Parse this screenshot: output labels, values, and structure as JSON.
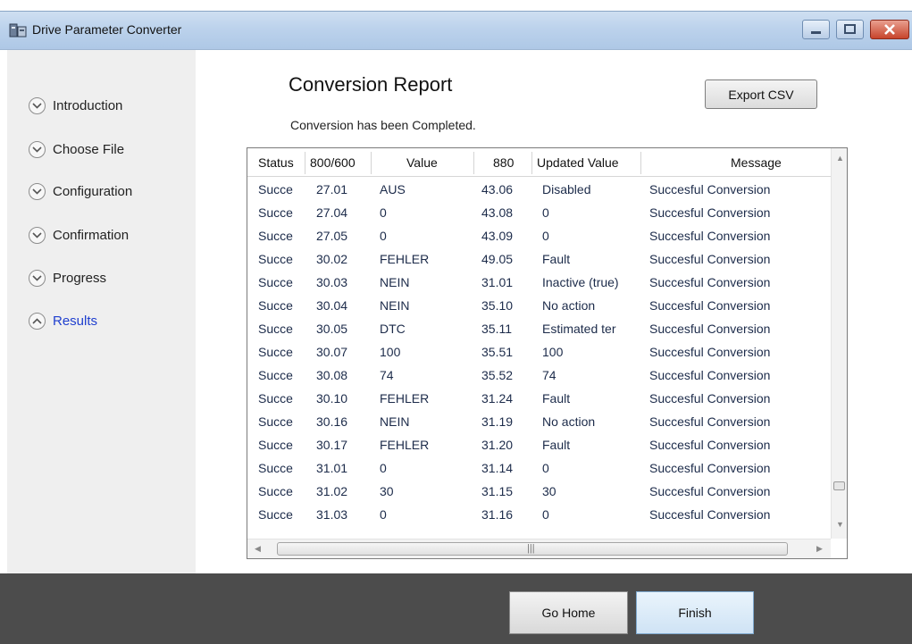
{
  "window": {
    "title": "Drive Parameter Converter"
  },
  "nav": {
    "items": [
      {
        "label": "Introduction",
        "state": "collapsed"
      },
      {
        "label": "Choose File",
        "state": "collapsed"
      },
      {
        "label": "Configuration",
        "state": "collapsed"
      },
      {
        "label": "Confirmation",
        "state": "collapsed"
      },
      {
        "label": "Progress",
        "state": "collapsed"
      },
      {
        "label": "Results",
        "state": "expanded"
      }
    ]
  },
  "report": {
    "title": "Conversion Report",
    "status": "Conversion has been Completed.",
    "export_label": "Export CSV"
  },
  "table": {
    "headers": [
      "Status",
      "800/600",
      "Value",
      "880",
      "Updated Value",
      "Message"
    ],
    "rows": [
      [
        "Succe",
        "27.01",
        "AUS",
        "43.06",
        "Disabled",
        "Succesful Conversion"
      ],
      [
        "Succe",
        "27.04",
        "0",
        "43.08",
        "0",
        "Succesful Conversion"
      ],
      [
        "Succe",
        "27.05",
        "0",
        "43.09",
        "0",
        "Succesful Conversion"
      ],
      [
        "Succe",
        "30.02",
        "FEHLER",
        "49.05",
        "Fault",
        "Succesful Conversion"
      ],
      [
        "Succe",
        "30.03",
        "NEIN",
        "31.01",
        "Inactive (true)",
        "Succesful Conversion"
      ],
      [
        "Succe",
        "30.04",
        "NEIN",
        "35.10",
        "No action",
        "Succesful Conversion"
      ],
      [
        "Succe",
        "30.05",
        "DTC",
        "35.11",
        "Estimated ter",
        "Succesful Conversion"
      ],
      [
        "Succe",
        "30.07",
        "100",
        "35.51",
        "100",
        "Succesful Conversion"
      ],
      [
        "Succe",
        "30.08",
        "74",
        "35.52",
        "74",
        "Succesful Conversion"
      ],
      [
        "Succe",
        "30.10",
        "FEHLER",
        "31.24",
        "Fault",
        "Succesful Conversion"
      ],
      [
        "Succe",
        "30.16",
        "NEIN",
        "31.19",
        "No action",
        "Succesful Conversion"
      ],
      [
        "Succe",
        "30.17",
        "FEHLER",
        "31.20",
        "Fault",
        "Succesful Conversion"
      ],
      [
        "Succe",
        "31.01",
        "0",
        "31.14",
        "0",
        "Succesful Conversion"
      ],
      [
        "Succe",
        "31.02",
        "30",
        "31.15",
        "30",
        "Succesful Conversion"
      ],
      [
        "Succe",
        "31.03",
        "0",
        "31.16",
        "0",
        "Succesful Conversion"
      ]
    ]
  },
  "footer": {
    "go_home_label": "Go Home",
    "finish_label": "Finish"
  },
  "colors": {
    "active_nav": "#1f3fcf",
    "footer_bg": "#4c4c4c",
    "cell_text": "#1c2b4a"
  },
  "icons": {
    "app": "drive-app-icon",
    "nav_collapsed": "chevron-down-icon",
    "nav_expanded": "chevron-up-icon"
  }
}
